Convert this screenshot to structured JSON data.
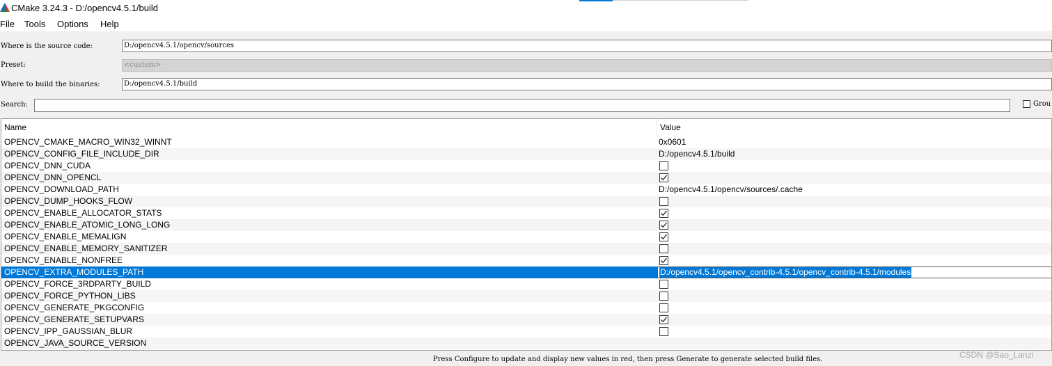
{
  "window": {
    "title": "CMake 3.24.3 - D:/opencv4.5.1/build"
  },
  "menu": [
    "File",
    "Tools",
    "Options",
    "Help"
  ],
  "source": {
    "label": "Where is the source code:",
    "value": "D:/opencv4.5.1/opencv/sources"
  },
  "preset": {
    "label": "Preset:",
    "value": "<custom>"
  },
  "binaries": {
    "label": "Where to build the binaries:",
    "value": "D:/opencv4.5.1/build"
  },
  "search": {
    "label": "Search:",
    "value": ""
  },
  "grouped": {
    "label": "Grou",
    "checked": false
  },
  "table": {
    "columns": [
      "Name",
      "Value"
    ],
    "rows": [
      {
        "name": "OPENCV_CMAKE_MACRO_WIN32_WINNT",
        "type": "text",
        "value": "0x0601"
      },
      {
        "name": "OPENCV_CONFIG_FILE_INCLUDE_DIR",
        "type": "text",
        "value": "D:/opencv4.5.1/build"
      },
      {
        "name": "OPENCV_DNN_CUDA",
        "type": "bool",
        "value": false
      },
      {
        "name": "OPENCV_DNN_OPENCL",
        "type": "bool",
        "value": true
      },
      {
        "name": "OPENCV_DOWNLOAD_PATH",
        "type": "text",
        "value": "D:/opencv4.5.1/opencv/sources/.cache"
      },
      {
        "name": "OPENCV_DUMP_HOOKS_FLOW",
        "type": "bool",
        "value": false
      },
      {
        "name": "OPENCV_ENABLE_ALLOCATOR_STATS",
        "type": "bool",
        "value": true
      },
      {
        "name": "OPENCV_ENABLE_ATOMIC_LONG_LONG",
        "type": "bool",
        "value": true
      },
      {
        "name": "OPENCV_ENABLE_MEMALIGN",
        "type": "bool",
        "value": true
      },
      {
        "name": "OPENCV_ENABLE_MEMORY_SANITIZER",
        "type": "bool",
        "value": false
      },
      {
        "name": "OPENCV_ENABLE_NONFREE",
        "type": "bool",
        "value": true
      },
      {
        "name": "OPENCV_EXTRA_MODULES_PATH",
        "type": "edit",
        "value": "D:/opencv4.5.1/opencv_contrib-4.5.1/opencv_contrib-4.5.1/modules",
        "selected": true
      },
      {
        "name": "OPENCV_FORCE_3RDPARTY_BUILD",
        "type": "bool",
        "value": false
      },
      {
        "name": "OPENCV_FORCE_PYTHON_LIBS",
        "type": "bool",
        "value": false
      },
      {
        "name": "OPENCV_GENERATE_PKGCONFIG",
        "type": "bool",
        "value": false
      },
      {
        "name": "OPENCV_GENERATE_SETUPVARS",
        "type": "bool",
        "value": true
      },
      {
        "name": "OPENCV_IPP_GAUSSIAN_BLUR",
        "type": "bool",
        "value": false
      },
      {
        "name": "OPENCV_JAVA_SOURCE_VERSION",
        "type": "text",
        "value": ""
      }
    ]
  },
  "status": "Press Configure to update and display new values in red, then press Generate to generate selected build files.",
  "watermark": "CSDN @Sao_Lanzi",
  "colors": {
    "selection": "#0078d7",
    "alt_row": "#f5f5f5",
    "disabled_field": "#d4d4d4"
  },
  "icons": {
    "app": "cmake-triangle-icon",
    "checkbox_check": "checkmark-icon"
  }
}
